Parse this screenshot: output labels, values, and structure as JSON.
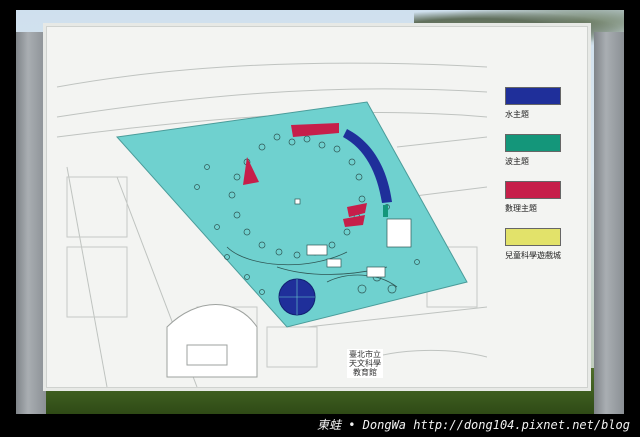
{
  "legend": {
    "items": [
      {
        "label": "水主題",
        "color": "#1f2f9a"
      },
      {
        "label": "波主題",
        "color": "#14967a"
      },
      {
        "label": "數理主題",
        "color": "#c61f4a"
      },
      {
        "label": "兒童科學遊戲城",
        "color": "#e2e26a"
      }
    ]
  },
  "map": {
    "museum_label_line1": "臺北市立",
    "museum_label_line2": "天文科學",
    "museum_label_line3": "教育館",
    "park_color": "#6fd1cf",
    "water_color": "#1f2f9a",
    "red_color": "#c61f4a"
  },
  "watermark": {
    "text": "東蛙 • DongWa http://dong104.pixnet.net/blog"
  }
}
